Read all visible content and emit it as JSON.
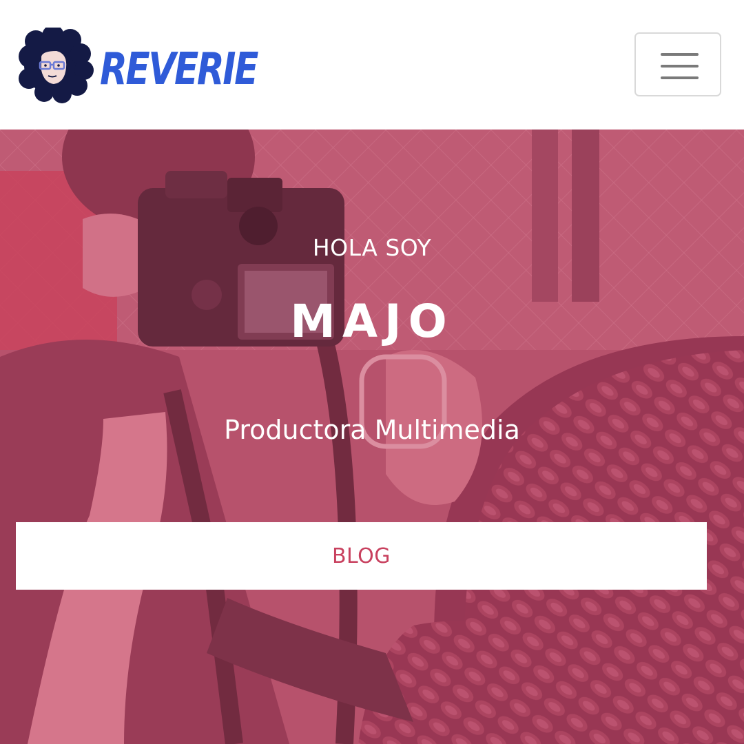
{
  "header": {
    "logo_text": "REVERIE",
    "menu_icon": "hamburger-menu-icon"
  },
  "hero": {
    "eyebrow": "HOLA SOY",
    "name": "MAJO",
    "role": "Productora Multimedia",
    "cta_label": "BLOG"
  },
  "colors": {
    "brand_blue": "#2f5bd8",
    "hero_tint": "#b4566e",
    "cta_text": "#c8405e",
    "header_bg": "#ffffff"
  }
}
